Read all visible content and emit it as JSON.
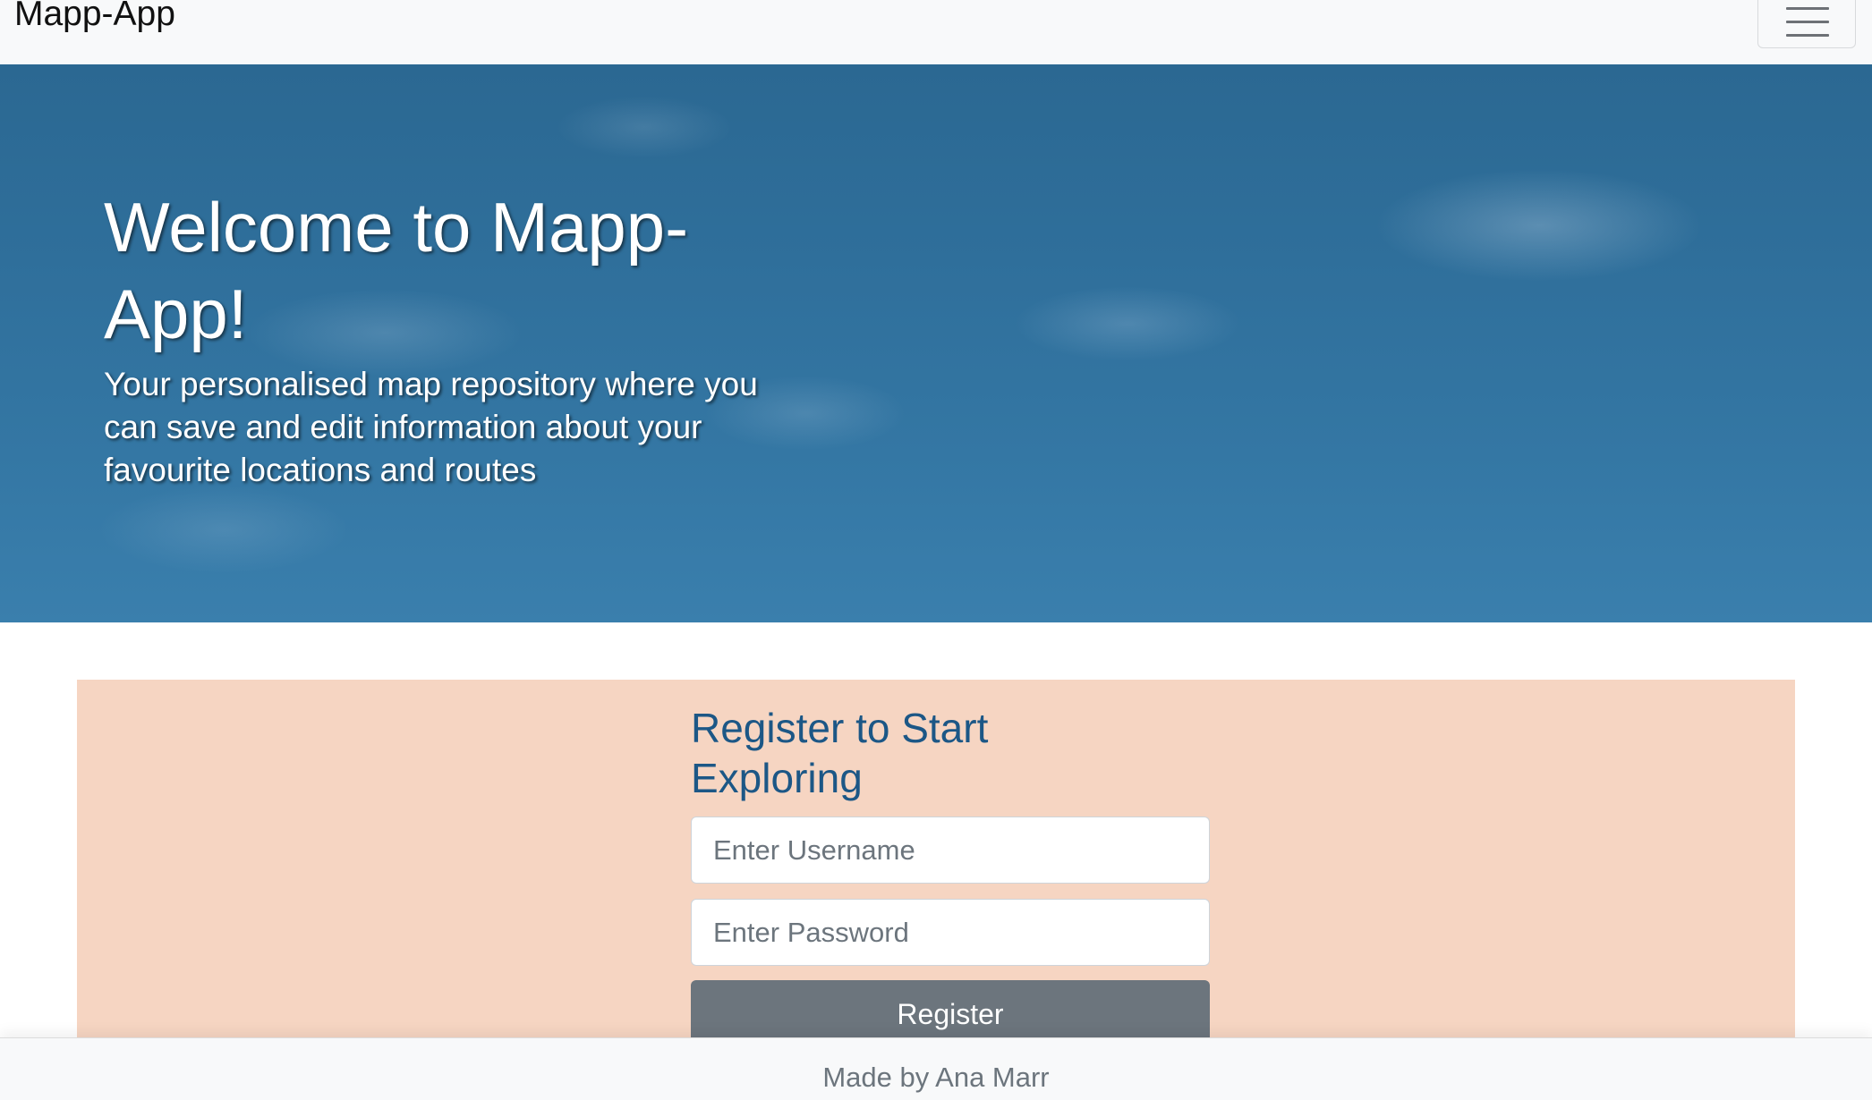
{
  "navbar": {
    "brand": "Mapp-App",
    "toggler_icon": "hamburger-menu-icon"
  },
  "hero": {
    "title": "Welcome to Mapp-App!",
    "subtitle": "Your personalised map repository where you can save and edit information about your favourite locations and routes"
  },
  "register": {
    "title": "Register to Start Exploring",
    "username_placeholder": "Enter Username",
    "username_value": "",
    "password_placeholder": "Enter Password",
    "password_value": "",
    "button_label": "Register"
  },
  "footer": {
    "text": "Made by Ana Marr"
  },
  "colors": {
    "navbar_bg": "#f8f9fa",
    "hero_sky": "#2f6f9b",
    "panel_bg": "#f6d5c2",
    "form_title": "#1c5786",
    "button_bg": "#6c757d",
    "footer_text": "#6c757d"
  }
}
